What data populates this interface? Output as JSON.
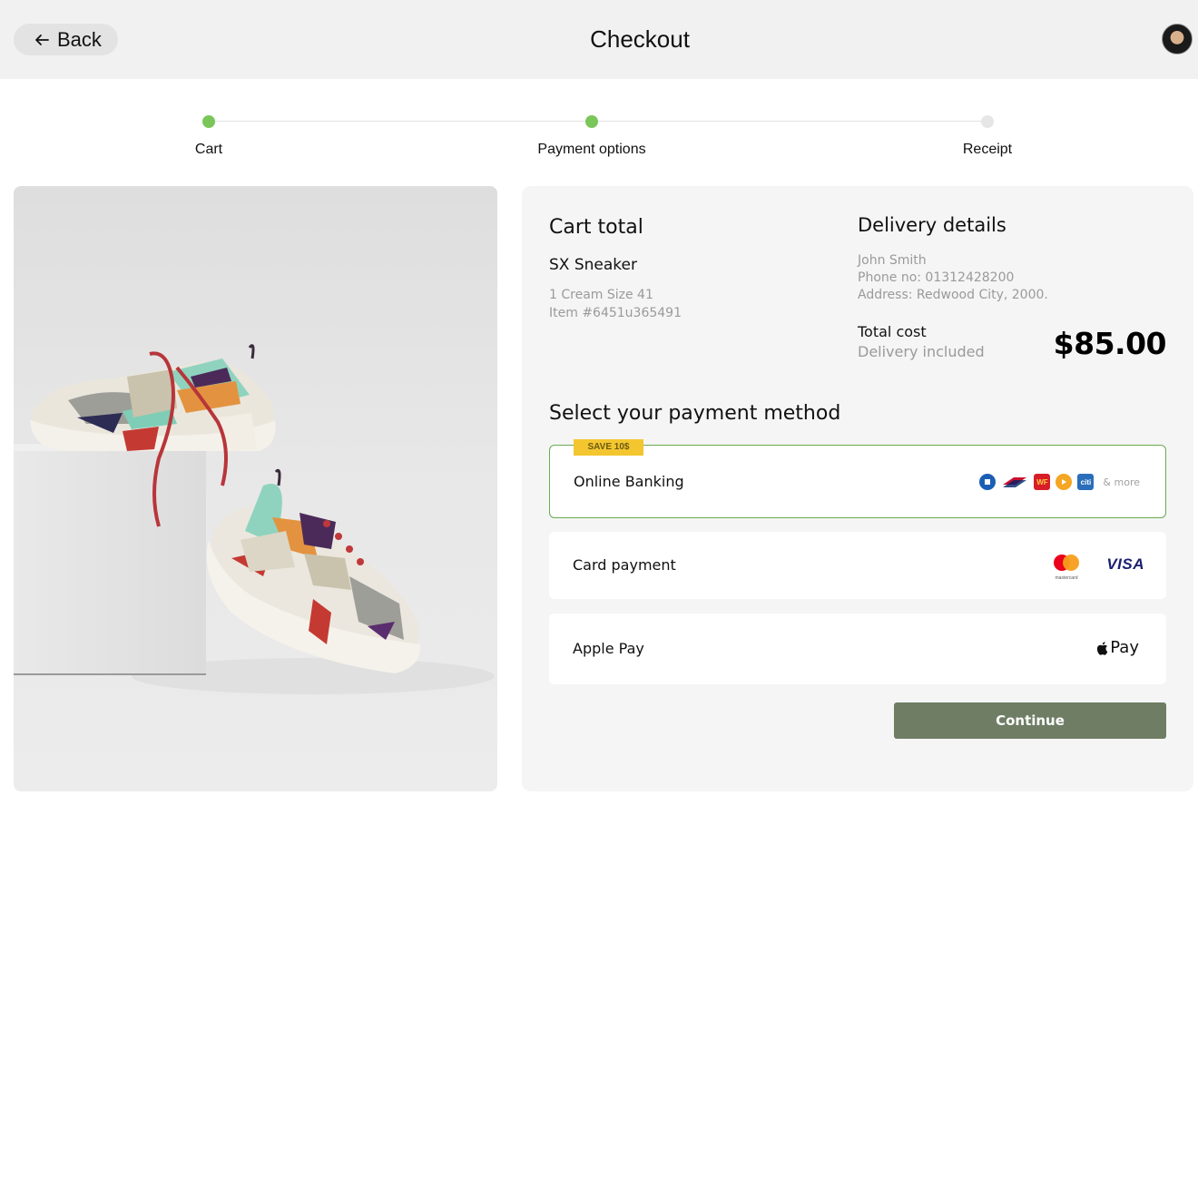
{
  "header": {
    "back_label": "Back",
    "title": "Checkout"
  },
  "stepper": {
    "steps": [
      {
        "label": "Cart",
        "state": "done"
      },
      {
        "label": "Payment options",
        "state": "done"
      },
      {
        "label": "Receipt",
        "state": "todo"
      }
    ]
  },
  "cart": {
    "title": "Cart total",
    "product_name": "SX Sneaker",
    "variant": "1 Cream Size 41",
    "item_no": "Item #6451u365491"
  },
  "delivery": {
    "title": "Delivery details",
    "name": "John Smith",
    "phone": "Phone no: 01312428200",
    "address": "Address: Redwood City, 2000.",
    "total_label": "Total cost",
    "total_note": "Delivery included",
    "total_value": "$85.00"
  },
  "payment": {
    "heading": "Select your payment method",
    "options": [
      {
        "label": "Online Banking",
        "badge": "SAVE 10$",
        "selected": true,
        "logos": [
          "chase-icon",
          "bofa-icon",
          "wells-fargo-icon",
          "orange-bank-icon",
          "citi-icon"
        ],
        "more": "& more"
      },
      {
        "label": "Card payment",
        "selected": false,
        "logos": [
          "mastercard-icon",
          "visa-icon"
        ],
        "mastercard_caption": "mastercard",
        "visa_text": "VISA"
      },
      {
        "label": "Apple Pay",
        "selected": false,
        "logos": [
          "apple-pay-icon"
        ],
        "apple_pay_text": "Pay"
      }
    ],
    "continue_label": "Continue"
  },
  "colors": {
    "accent_green": "#7bc65a",
    "selected_border": "#6aab4f",
    "continue_bg": "#6e7d64",
    "badge_bg": "#f3c630"
  }
}
